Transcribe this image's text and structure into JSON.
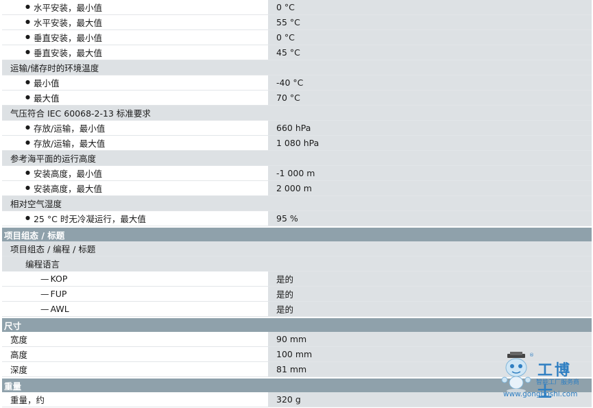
{
  "rows": [
    {
      "type": "bullet",
      "label": "水平安装，最小值",
      "value": "0 °C"
    },
    {
      "type": "bullet",
      "label": "水平安装，最大值",
      "value": "55 °C"
    },
    {
      "type": "bullet",
      "label": "垂直安装，最小值",
      "value": "0 °C"
    },
    {
      "type": "bullet",
      "label": "垂直安装，最大值",
      "value": "45 °C"
    },
    {
      "type": "subhead",
      "label": "运输/储存时的环境温度"
    },
    {
      "type": "bullet",
      "label": "最小值",
      "value": "-40 °C"
    },
    {
      "type": "bullet",
      "label": "最大值",
      "value": "70 °C"
    },
    {
      "type": "subhead",
      "label": "气压符合 IEC 60068-2-13 标准要求"
    },
    {
      "type": "bullet",
      "label": "存放/运输，最小值",
      "value": "660 hPa"
    },
    {
      "type": "bullet",
      "label": "存放/运输，最大值",
      "value": "1 080 hPa"
    },
    {
      "type": "subhead",
      "label": "参考海平面的运行高度"
    },
    {
      "type": "bullet",
      "label": "安装高度，最小值",
      "value": "-1 000 m"
    },
    {
      "type": "bullet",
      "label": "安装高度，最大值",
      "value": "2 000 m"
    },
    {
      "type": "subhead",
      "label": "相对空气湿度"
    },
    {
      "type": "bullet",
      "label": "25 °C 时无冷凝运行，最大值",
      "value": "95 %"
    },
    {
      "type": "section",
      "label": "项目组态 / 标题"
    },
    {
      "type": "midhead",
      "label": "项目组态 / 编程 / 标题"
    },
    {
      "type": "subhead2",
      "label": "编程语言"
    },
    {
      "type": "dash",
      "label": "KOP",
      "value": "是的"
    },
    {
      "type": "dash",
      "label": "FUP",
      "value": "是的"
    },
    {
      "type": "dash",
      "label": "AWL",
      "value": "是的"
    },
    {
      "type": "section",
      "label": "尺寸"
    },
    {
      "type": "plain",
      "label": "宽度",
      "value": "90 mm"
    },
    {
      "type": "plain",
      "label": "高度",
      "value": "100 mm"
    },
    {
      "type": "plain",
      "label": "深度",
      "value": "81 mm"
    },
    {
      "type": "section",
      "label": "重量"
    },
    {
      "type": "plain",
      "label": "重量，约",
      "value": "320 g"
    }
  ],
  "watermark": {
    "brand": "工博士",
    "tagline": "智能工厂服务商",
    "url": "www.gongboshi.com",
    "reg": "®"
  },
  "colors": {
    "section_bg": "#8fa1ab",
    "value_bg": "#dde1e4",
    "watermark": "#2f7fc2"
  }
}
